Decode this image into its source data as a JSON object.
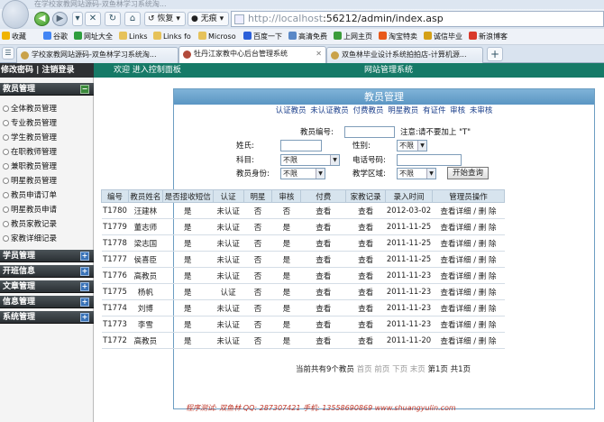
{
  "browser": {
    "window_title": "在学校家教网站源码-双鱼林学习系统淘...",
    "back_icon": "left-arrow-icon",
    "restore_label": "恢复",
    "no_image_label": "无痕",
    "address_url_host": "http://localhost",
    "address_url_rest": ":56212/admin/index.asp",
    "favorites": [
      {
        "label": "收藏",
        "icon": "star-icon"
      },
      {
        "label": "谷歌",
        "icon": "google-icon"
      },
      {
        "label": "网址大全",
        "icon": "web-icon"
      },
      {
        "label": "Links",
        "icon": "folder-icon"
      },
      {
        "label": "Links fo",
        "icon": "folder-icon"
      },
      {
        "label": "Microso",
        "icon": "folder-icon"
      },
      {
        "label": "百度一下",
        "icon": "baidu-icon"
      },
      {
        "label": "高清免费",
        "icon": "video-icon"
      },
      {
        "label": "上网主页",
        "icon": "home-icon"
      },
      {
        "label": "淘宝特卖",
        "icon": "taobao-icon"
      },
      {
        "label": "诚信毕业",
        "icon": "cert-icon"
      },
      {
        "label": "新浪博客",
        "icon": "sina-icon"
      }
    ],
    "tabs": [
      {
        "label": "学校家教网站源码-双鱼林学习系统淘...",
        "active": false
      },
      {
        "label": "牡丹江家教中心后台管理系统",
        "active": true
      },
      {
        "label": "双鱼林毕业设计系统拍拍店-计算机源...",
        "active": false
      }
    ],
    "new_tab_label": "+"
  },
  "sidebar": {
    "top_links": "修改密码 | 注销登录",
    "sections": [
      {
        "title": "教员管理",
        "expanded": true,
        "items": [
          "全体教员管理",
          "专业教员管理",
          "学生教员管理",
          "在职教师管理",
          "兼职教员管理",
          "明星教员管理",
          "教员申请订单",
          "明星教员申请",
          "教员家教记录",
          "家教详细记录"
        ]
      },
      {
        "title": "学员管理",
        "expanded": false,
        "items": []
      },
      {
        "title": "开班信息",
        "expanded": false,
        "items": []
      },
      {
        "title": "文章管理",
        "expanded": false,
        "items": []
      },
      {
        "title": "信息管理",
        "expanded": false,
        "items": []
      },
      {
        "title": "系统管理",
        "expanded": false,
        "items": []
      }
    ]
  },
  "header": {
    "welcome": "欢迎  进入控制面板",
    "system_title": "网站管理系统"
  },
  "panel": {
    "title": "教员管理",
    "filter_links": [
      "认证教员",
      "未认证教员",
      "付费教员",
      "明星教员",
      "有证件",
      "审核",
      "未审核"
    ],
    "search": {
      "id_label": "教员编号:",
      "id_value": "",
      "note": "注意:请不要加上 \"T\"",
      "name_label": "姓氏:",
      "name_value": "",
      "gender_label": "性别:",
      "gender_value": "不限",
      "subject_label": "科目:",
      "subject_value": "不限",
      "phone_label": "电话号码:",
      "phone_value": "",
      "identity_label": "教员身份:",
      "identity_value": "不限",
      "area_label": "教学区域:",
      "area_value": "不限",
      "submit_label": "开始查询"
    },
    "table": {
      "headers": [
        "编号",
        "教员姓名",
        "是否接收短信",
        "认证",
        "明星",
        "审核",
        "付费",
        "家教记录",
        "录入时间",
        "管理员操作"
      ],
      "rows": [
        {
          "id": "T1780",
          "name": "汪建林",
          "sms": "是",
          "auth": "未认证",
          "star": "否",
          "review": "否",
          "pay": "查看",
          "record": "查看",
          "date": "2012-03-02",
          "op": "查看详细 / 删  除"
        },
        {
          "id": "T1779",
          "name": "董志师",
          "sms": "是",
          "auth": "未认证",
          "star": "否",
          "review": "是",
          "pay": "查看",
          "record": "查看",
          "date": "2011-11-25",
          "op": "查看详细 / 删  除"
        },
        {
          "id": "T1778",
          "name": "梁志国",
          "sms": "是",
          "auth": "未认证",
          "star": "否",
          "review": "是",
          "pay": "查看",
          "record": "查看",
          "date": "2011-11-25",
          "op": "查看详细 / 删  除"
        },
        {
          "id": "T1777",
          "name": "侯喜臣",
          "sms": "是",
          "auth": "未认证",
          "star": "否",
          "review": "是",
          "pay": "查看",
          "record": "查看",
          "date": "2011-11-25",
          "op": "查看详细 / 删  除"
        },
        {
          "id": "T1776",
          "name": "高教员",
          "sms": "是",
          "auth": "未认证",
          "star": "否",
          "review": "是",
          "pay": "查看",
          "record": "查看",
          "date": "2011-11-23",
          "op": "查看详细 / 删  除"
        },
        {
          "id": "T1775",
          "name": "杨帆",
          "sms": "是",
          "auth": "认证",
          "star": "否",
          "review": "是",
          "pay": "查看",
          "record": "查看",
          "date": "2011-11-23",
          "op": "查看详细 / 删  除"
        },
        {
          "id": "T1774",
          "name": "刘博",
          "sms": "是",
          "auth": "未认证",
          "star": "否",
          "review": "是",
          "pay": "查看",
          "record": "查看",
          "date": "2011-11-23",
          "op": "查看详细 / 删  除"
        },
        {
          "id": "T1773",
          "name": "李雪",
          "sms": "是",
          "auth": "未认证",
          "star": "否",
          "review": "是",
          "pay": "查看",
          "record": "查看",
          "date": "2011-11-23",
          "op": "查看详细 / 删  除"
        },
        {
          "id": "T1772",
          "name": "高教员",
          "sms": "是",
          "auth": "未认证",
          "star": "否",
          "review": "是",
          "pay": "查看",
          "record": "查看",
          "date": "2011-11-20",
          "op": "查看详细 / 删  除"
        }
      ]
    },
    "pager": {
      "total_text": "当前共有9个教员",
      "first": "首页",
      "prev": "前页",
      "next": "下页",
      "last": "末页",
      "current": "第1页",
      "total_pages": "共1页"
    }
  },
  "footer": "程序测试: 双鱼林  QQ: 287307421  手机: 13558690869  www.shuangyulin.com",
  "colors": {
    "header_green": "#167a67",
    "panel_blue": "#5b96c3",
    "sidebar_dark": "#2a2f33",
    "footer_red": "#c0392b"
  }
}
